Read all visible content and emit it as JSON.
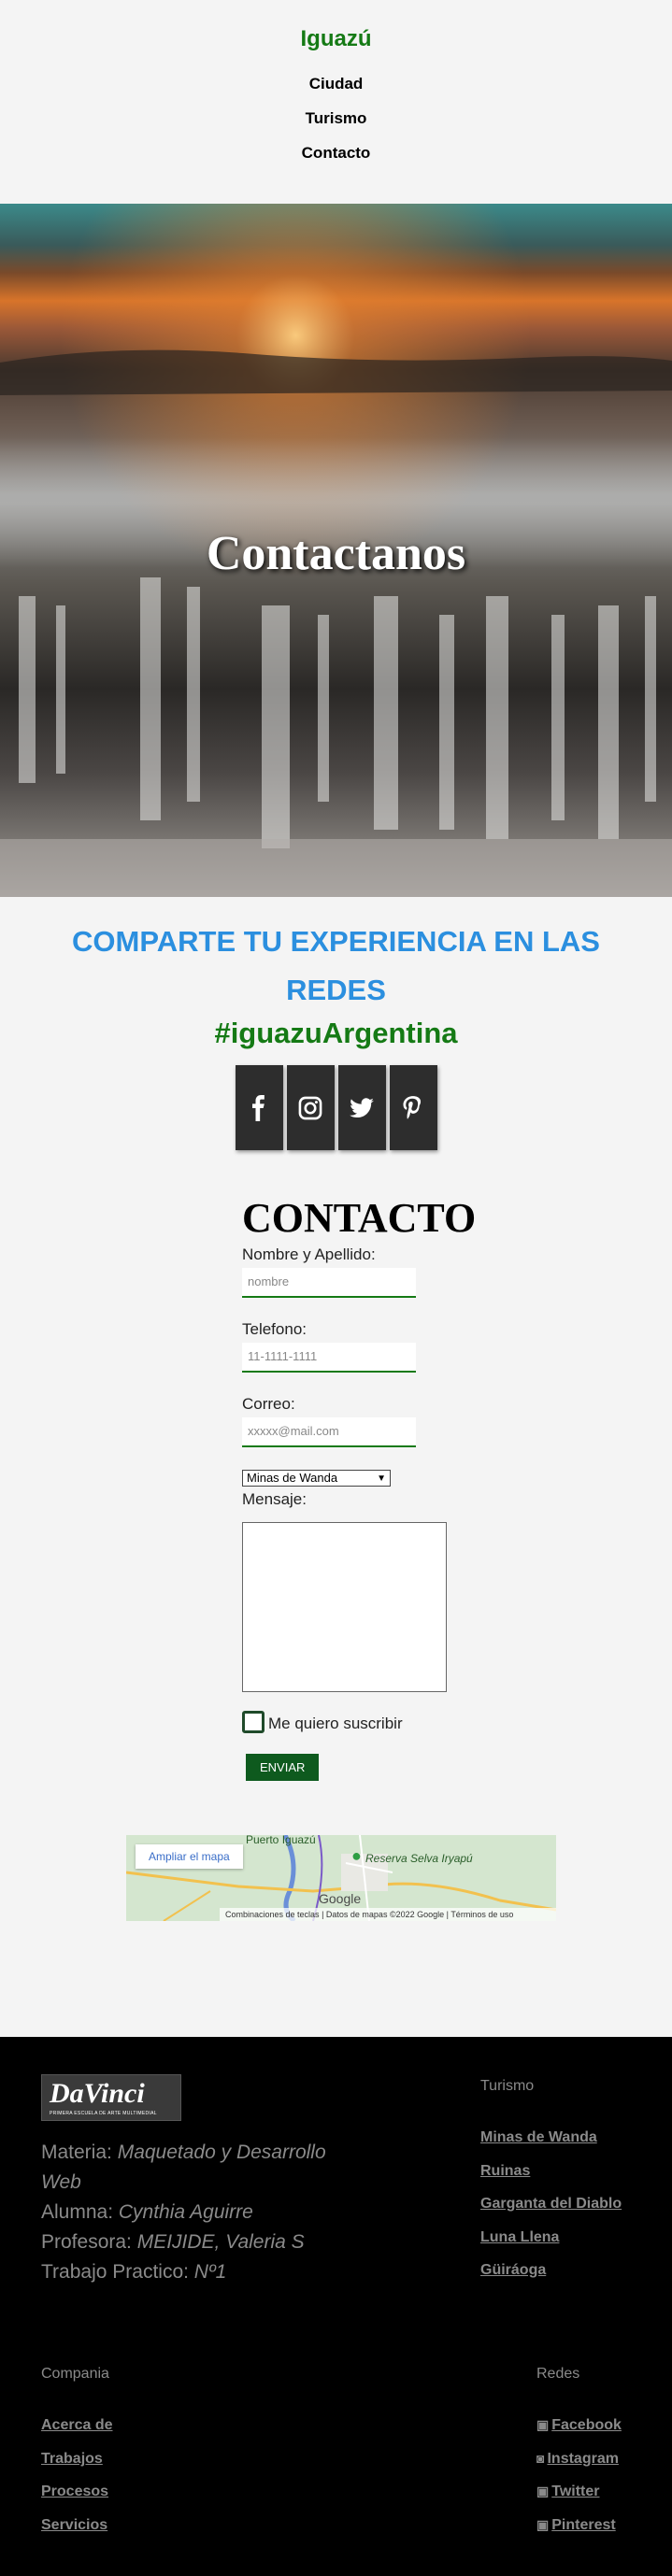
{
  "header": {
    "brand": "Iguazú",
    "nav": [
      "Ciudad",
      "Turismo",
      "Contacto"
    ]
  },
  "hero": {
    "title": "Contactanos"
  },
  "share": {
    "heading": "COMPARTE TU EXPERIENCIA EN LAS REDES",
    "hashtag": "#iguazuArgentina",
    "icons": [
      "facebook-icon",
      "instagram-icon",
      "twitter-icon",
      "pinterest-icon"
    ]
  },
  "form": {
    "title": "CONTACTO",
    "name_label": "Nombre y Apellido:",
    "name_placeholder": "nombre",
    "phone_label": "Telefono:",
    "phone_placeholder": "11-1111-1111",
    "email_label": "Correo:",
    "email_placeholder": "xxxxx@mail.com",
    "select_value": "Minas de Wanda",
    "message_label": "Mensaje:",
    "subscribe_label": "Me quiero suscribir",
    "submit_label": "ENVIAR"
  },
  "map": {
    "link": "Ampliar el mapa",
    "place1": "Puerto Iguazú",
    "place2": "Reserva Selva Iryapú",
    "google": "Google",
    "footer_shortcuts": "Combinaciones de teclas",
    "footer_data": "Datos de mapas ©2022 Google",
    "footer_terms": "Términos de uso"
  },
  "footer": {
    "logo_text": "DaVinci",
    "logo_subtext": "PRIMERA ESCUELA DE ARTE MULTIMEDIAL",
    "credits": {
      "materia_label": "Materia: ",
      "materia_value": "Maquetado y Desarrollo Web",
      "alumna_label": "Alumna: ",
      "alumna_value": "Cynthia Aguirre",
      "profesora_label": "Profesora: ",
      "profesora_value": "MEIJIDE, Valeria S",
      "tp_label": "Trabajo Practico: ",
      "tp_value": "Nº1"
    },
    "turismo_title": "Turismo",
    "turismo_links": [
      "Minas de Wanda",
      "Ruinas",
      "Garganta del Diablo",
      "Luna Llena",
      "Güiráoga"
    ],
    "compania_title": "Compania",
    "compania_links": [
      "Acerca de",
      "Trabajos",
      "Procesos",
      "Servicios"
    ],
    "redes_title": "Redes",
    "redes_links": [
      "Facebook",
      "Instagram",
      "Twitter",
      "Pinterest"
    ]
  },
  "colors": {
    "brand_green": "#157a15",
    "heading_blue": "#2b8fdf",
    "social_dark": "#2d2d2d",
    "button_green": "#0e5a1e",
    "footer_bg": "#000000"
  }
}
